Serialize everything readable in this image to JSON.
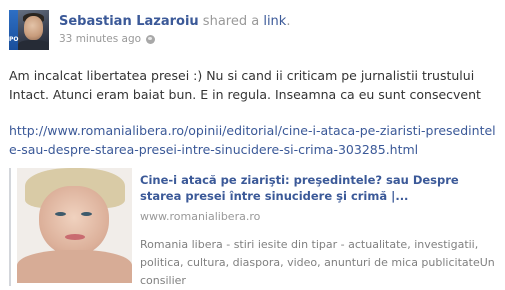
{
  "post": {
    "author": "Sebastian Lazaroiu",
    "action_text": " shared a ",
    "link_word": "link",
    "period": ".",
    "timestamp": "33 minutes ago",
    "privacy_icon": "globe-icon",
    "message": "Am incalcat libertatea presei :) Nu si cand ii criticam pe jurnalistii trustului Intact. Atunci eram baiat bun. E in regula. Inseamna ca eu sunt consecvent",
    "url": "http://www.romanialibera.ro/opinii/editorial/cine-i-ataca-pe-ziaristi-presedintele-sau-despre-starea-presei-intre-sinucidere-si-crima-303285.html"
  },
  "avatar": {
    "tag_text": "PO"
  },
  "attachment": {
    "title": "Cine-i atacă pe ziarişti: preşedintele? sau Despre starea presei între sinucidere şi crimă |...",
    "domain": "www.romanialibera.ro",
    "description": "Romania libera - stiri iesite din tipar - actualitate, investigatii, politica, cultura, diaspora, video, anunturi de mica publicitateUn consilier"
  },
  "colors": {
    "link_blue": "#3b5998",
    "meta_gray": "#999999",
    "text": "#333333"
  }
}
